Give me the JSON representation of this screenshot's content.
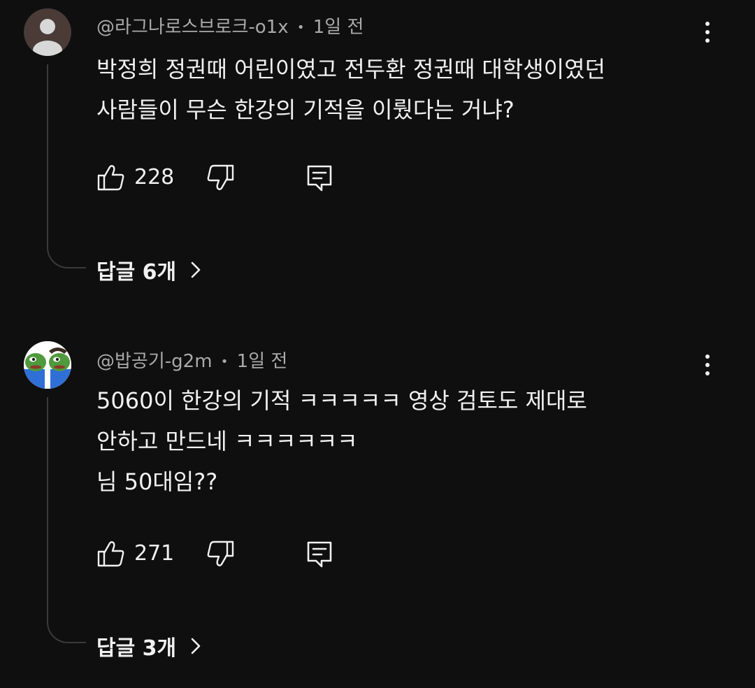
{
  "comments": [
    {
      "author": "@라그나로스브로크-o1x",
      "separator": "•",
      "time": "1일 전",
      "lines": [
        "박정희 정권때 어린이였고 전두환 정권때 대학생이였던",
        "사람들이 무슨 한강의 기적을 이뤘다는 거냐?"
      ],
      "likes": "228",
      "replies_label": "답글 6개",
      "avatar_bg": "#4a3b37",
      "avatar_icon": "default-person-icon"
    },
    {
      "author": "@밥공기-g2m",
      "separator": "•",
      "time": "1일 전",
      "lines": [
        "5060이 한강의 기적 ㅋㅋㅋㅋㅋ 영상 검토도 제대로",
        "안하고 만드네 ㅋㅋㅋㅋㅋㅋ",
        "님 50대임??"
      ],
      "likes": "271",
      "replies_label": "답글 3개",
      "avatar_icon": "pepe-avatar"
    }
  ],
  "icons": {
    "like": "thumbs-up-icon",
    "dislike": "thumbs-down-icon",
    "reply": "comment-reply-icon",
    "menu": "more-vertical-icon",
    "chevron": "chevron-right-icon"
  },
  "colors": {
    "background": "#0f0f0f",
    "text": "#f1f1f1",
    "meta": "#aaaaaa",
    "thread_line": "#3a3a3a"
  }
}
